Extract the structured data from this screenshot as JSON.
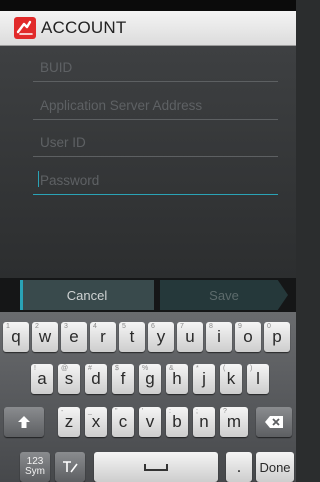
{
  "title_bar": {
    "title": "ACCOUNT",
    "icon": "app-logo-icon",
    "icon_color": "#e12a2a"
  },
  "form": {
    "fields": [
      {
        "placeholder": "BUID",
        "value": ""
      },
      {
        "placeholder": "Application Server Address",
        "value": ""
      },
      {
        "placeholder": "User ID",
        "value": ""
      },
      {
        "placeholder": "Password",
        "value": "",
        "focused": true
      }
    ],
    "accent_color": "#2aa3b6"
  },
  "buttons": {
    "cancel": "Cancel",
    "save": "Save"
  },
  "keyboard": {
    "row1": [
      {
        "key": "q",
        "hint": "1"
      },
      {
        "key": "w",
        "hint": "2"
      },
      {
        "key": "e",
        "hint": "3"
      },
      {
        "key": "r",
        "hint": "4"
      },
      {
        "key": "t",
        "hint": "5"
      },
      {
        "key": "y",
        "hint": "6"
      },
      {
        "key": "u",
        "hint": "7"
      },
      {
        "key": "i",
        "hint": "8"
      },
      {
        "key": "o",
        "hint": "9"
      },
      {
        "key": "p",
        "hint": "0"
      }
    ],
    "row2": [
      {
        "key": "a",
        "hint": "!"
      },
      {
        "key": "s",
        "hint": "@"
      },
      {
        "key": "d",
        "hint": "#"
      },
      {
        "key": "f",
        "hint": "$"
      },
      {
        "key": "g",
        "hint": "%"
      },
      {
        "key": "h",
        "hint": "&"
      },
      {
        "key": "j",
        "hint": "*"
      },
      {
        "key": "k",
        "hint": "("
      },
      {
        "key": "l",
        "hint": ")"
      }
    ],
    "row3": [
      {
        "key": "z",
        "hint": "-"
      },
      {
        "key": "x",
        "hint": "_"
      },
      {
        "key": "c",
        "hint": "\""
      },
      {
        "key": "v",
        "hint": "'"
      },
      {
        "key": "b",
        "hint": ":"
      },
      {
        "key": "n",
        "hint": ";"
      },
      {
        "key": "m",
        "hint": "?"
      }
    ],
    "shift_icon": "shift-arrow-icon",
    "backspace_icon": "backspace-icon",
    "sym_label": "123\nSym",
    "handwriting_icon": "handwriting-icon",
    "space_icon": "space-bar-icon",
    "period": ".",
    "done": "Done"
  }
}
